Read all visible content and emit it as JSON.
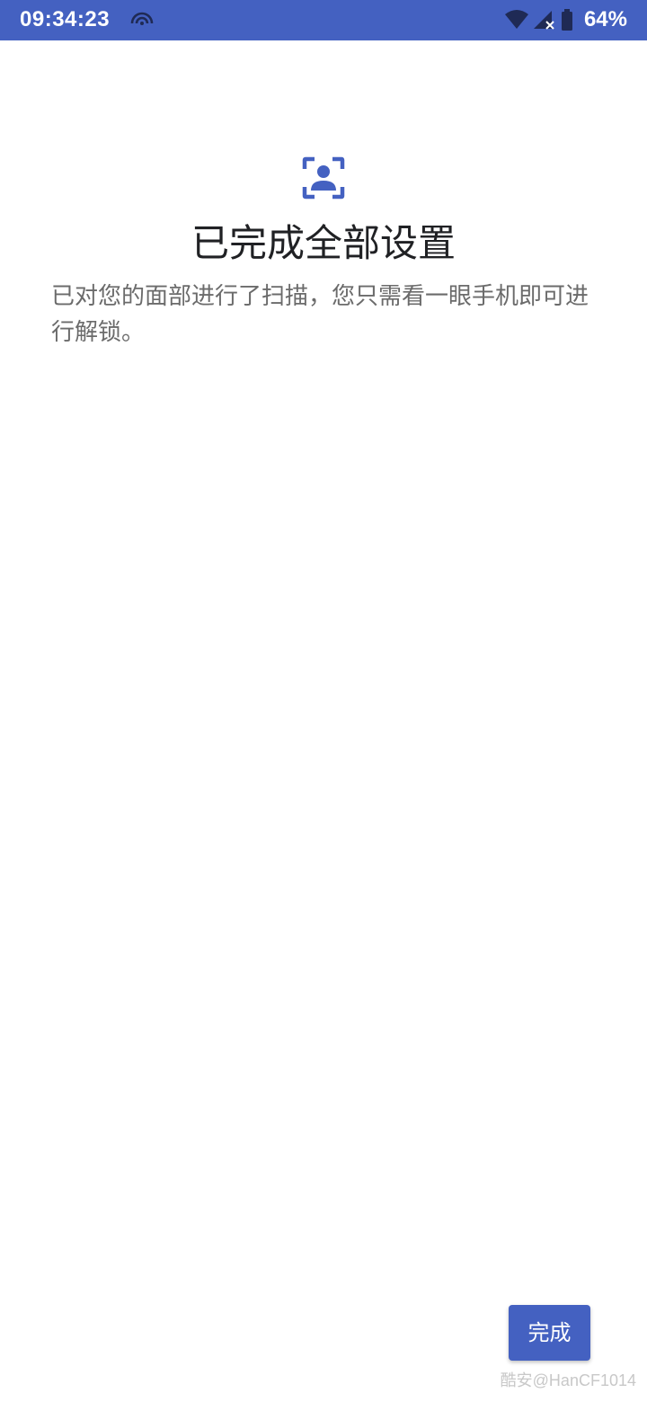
{
  "status_bar": {
    "time": "09:34:23",
    "battery_percent": "64%",
    "icons": [
      "hotspot-icon",
      "wifi-icon",
      "signal-no-service-icon",
      "battery-icon"
    ],
    "background": "#4461C1"
  },
  "header": {
    "icon": "face-scan-icon",
    "title": "已完成全部设置",
    "description": "已对您的面部进行了扫描，您只需看一眼手机即可进行解锁。"
  },
  "footer": {
    "done_label": "完成"
  },
  "watermark": "酷安@HanCF1014",
  "colors": {
    "accent": "#4461C1",
    "title": "#202124",
    "body_text": "#6b6b6b"
  }
}
